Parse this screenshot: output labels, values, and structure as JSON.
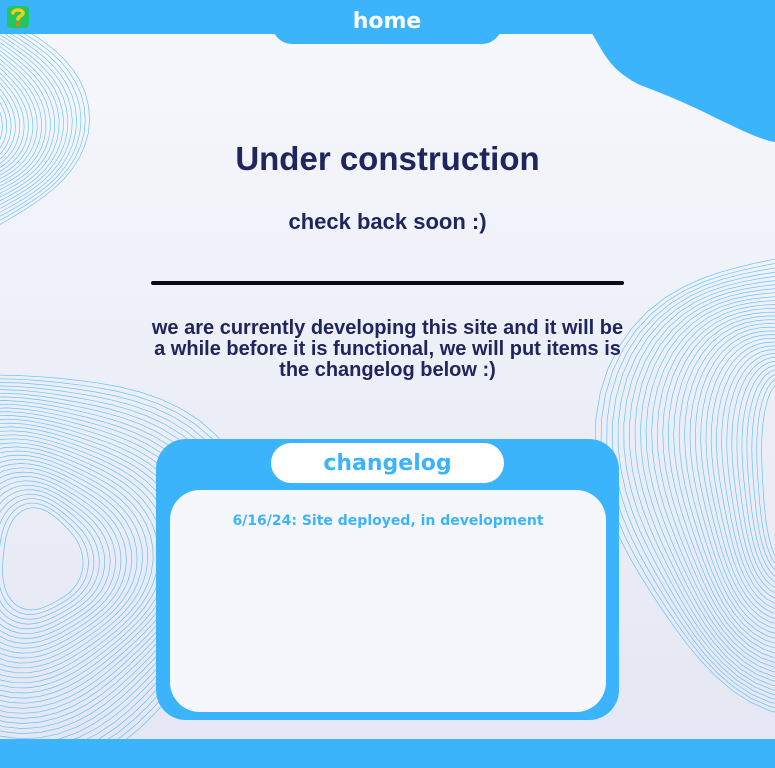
{
  "header": {
    "home_label": "home",
    "logo_icon": "puzzle-question-logo-icon"
  },
  "main": {
    "title": "Under construction",
    "subtitle": "check back soon :)",
    "message": "we are currently developing this site and it will be a while before it is functional, we will put items is the changelog below :)"
  },
  "changelog": {
    "title": "changelog",
    "entries": [
      "6/16/24: Site deployed, in development"
    ]
  },
  "colors": {
    "accent": "#3cb4fb",
    "heading_text": "#20255e",
    "background": "#f3f4fa",
    "divider": "#0b0b16"
  }
}
